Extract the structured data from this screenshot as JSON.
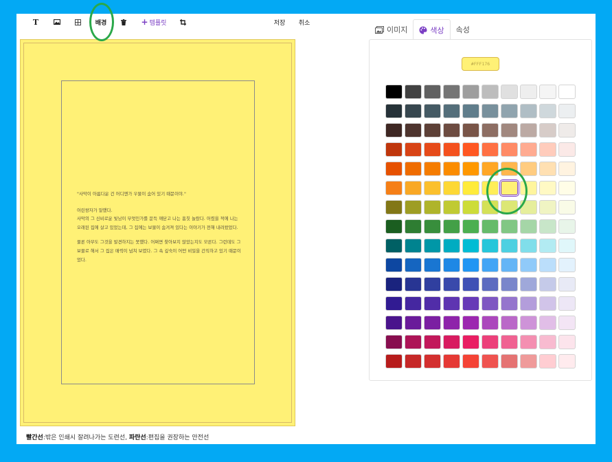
{
  "toolbar": {
    "text_glyph": "T",
    "background_label": "배경",
    "template_label": "템플릿",
    "save_label": "저장",
    "cancel_label": "취소"
  },
  "story": {
    "p1": "\"사막이 아름다운 건 어디엔가 우물이 숨어 있기 때문이야.\"",
    "p2": "어린왕자가 말했다.\n사막의 그 신비로운 빛남이 무엇인가를 문득 깨닫고 나는 흠칫 놀랐다. 어렸을 적에 나는 오래된 집에 살고 있었는데, 그 집에는 보물이 숨겨져 있다는 이야기가 전해 내려왔었다.",
    "p3": "물론 아무도 그것을 발견하지는 못했다. 어쩌면 찾아보지 않았는지도 모른다. 그런데도 그 보물로 해서 그 집은 매력이 넘쳐 보였다. 그 속 깊숙이 어떤 비밀을 간직하고 있기 때문이었다."
  },
  "caption": {
    "red_label": "빨간선",
    "red_desc": ":밖은 인쇄시 잘려나가는 도련선, ",
    "blue_label": "파란선",
    "blue_desc": ":편집을 권장하는 안전선"
  },
  "tabs": [
    {
      "label": "이미지",
      "icon": "image-icon"
    },
    {
      "label": "색상",
      "icon": "palette-icon",
      "active": true
    },
    {
      "label": "속성",
      "icon": ""
    }
  ],
  "selected_color": "#FFF176",
  "selected_cell": [
    5,
    6
  ],
  "accent": "#7b3fc4",
  "palette": [
    [
      "#000000",
      "#424242",
      "#616161",
      "#757575",
      "#9e9e9e",
      "#bdbdbd",
      "#e0e0e0",
      "#eeeeee",
      "#f5f5f5",
      "#ffffff"
    ],
    [
      "#263238",
      "#37474f",
      "#455a64",
      "#546e7a",
      "#607d8b",
      "#78909c",
      "#90a4ae",
      "#b0bec5",
      "#cfd8dc",
      "#eceff1"
    ],
    [
      "#3e2723",
      "#4e342e",
      "#5d4037",
      "#6d4c41",
      "#795548",
      "#8d6e63",
      "#a1887f",
      "#bcaaa4",
      "#d7ccc8",
      "#efebe9"
    ],
    [
      "#bf360c",
      "#d84315",
      "#e64a19",
      "#f4511e",
      "#ff5722",
      "#ff7043",
      "#ff8a65",
      "#ffab91",
      "#ffccbc",
      "#fbe9e7"
    ],
    [
      "#e65100",
      "#ef6c00",
      "#f57c00",
      "#fb8c00",
      "#ff9800",
      "#ffa726",
      "#ffb74d",
      "#ffcc80",
      "#ffe0b2",
      "#fff3e0"
    ],
    [
      "#f57f17",
      "#f9a825",
      "#fbc02d",
      "#fdd835",
      "#ffeb3b",
      "#ffee58",
      "#fff176",
      "#fff59d",
      "#fff9c4",
      "#fffde7"
    ],
    [
      "#827717",
      "#9e9d24",
      "#afb42b",
      "#c0ca33",
      "#cddc39",
      "#d4e157",
      "#dce775",
      "#e6ee9c",
      "#f0f4c3",
      "#f9fbe7"
    ],
    [
      "#1b5e20",
      "#2e7d32",
      "#388e3c",
      "#43a047",
      "#4caf50",
      "#66bb6a",
      "#81c784",
      "#a5d6a7",
      "#c8e6c9",
      "#e8f5e9"
    ],
    [
      "#006064",
      "#00838f",
      "#0097a7",
      "#00acc1",
      "#00bcd4",
      "#26c6da",
      "#4dd0e1",
      "#80deea",
      "#b2ebf2",
      "#e0f7fa"
    ],
    [
      "#0d47a1",
      "#1565c0",
      "#1976d2",
      "#1e88e5",
      "#2196f3",
      "#42a5f5",
      "#64b5f6",
      "#90caf9",
      "#bbdefb",
      "#e3f2fd"
    ],
    [
      "#1a237e",
      "#283593",
      "#303f9f",
      "#3949ab",
      "#3f51b5",
      "#5c6bc0",
      "#7986cb",
      "#9fa8da",
      "#c5cae9",
      "#e8eaf6"
    ],
    [
      "#311b92",
      "#4527a0",
      "#512da8",
      "#5e35b1",
      "#673ab7",
      "#7e57c2",
      "#9575cd",
      "#b39ddb",
      "#d1c4e9",
      "#ede7f6"
    ],
    [
      "#4a148c",
      "#6a1b9a",
      "#7b1fa2",
      "#8e24aa",
      "#9c27b0",
      "#ab47bc",
      "#ba68c8",
      "#ce93d8",
      "#e1bee7",
      "#f3e5f5"
    ],
    [
      "#880e4f",
      "#ad1457",
      "#c2185b",
      "#d81b60",
      "#e91e63",
      "#ec407a",
      "#f06292",
      "#f48fb1",
      "#f8bbd0",
      "#fce4ec"
    ],
    [
      "#b71c1c",
      "#c62828",
      "#d32f2f",
      "#e53935",
      "#f44336",
      "#ef5350",
      "#e57373",
      "#ef9a9a",
      "#ffcdd2",
      "#ffebee"
    ]
  ]
}
